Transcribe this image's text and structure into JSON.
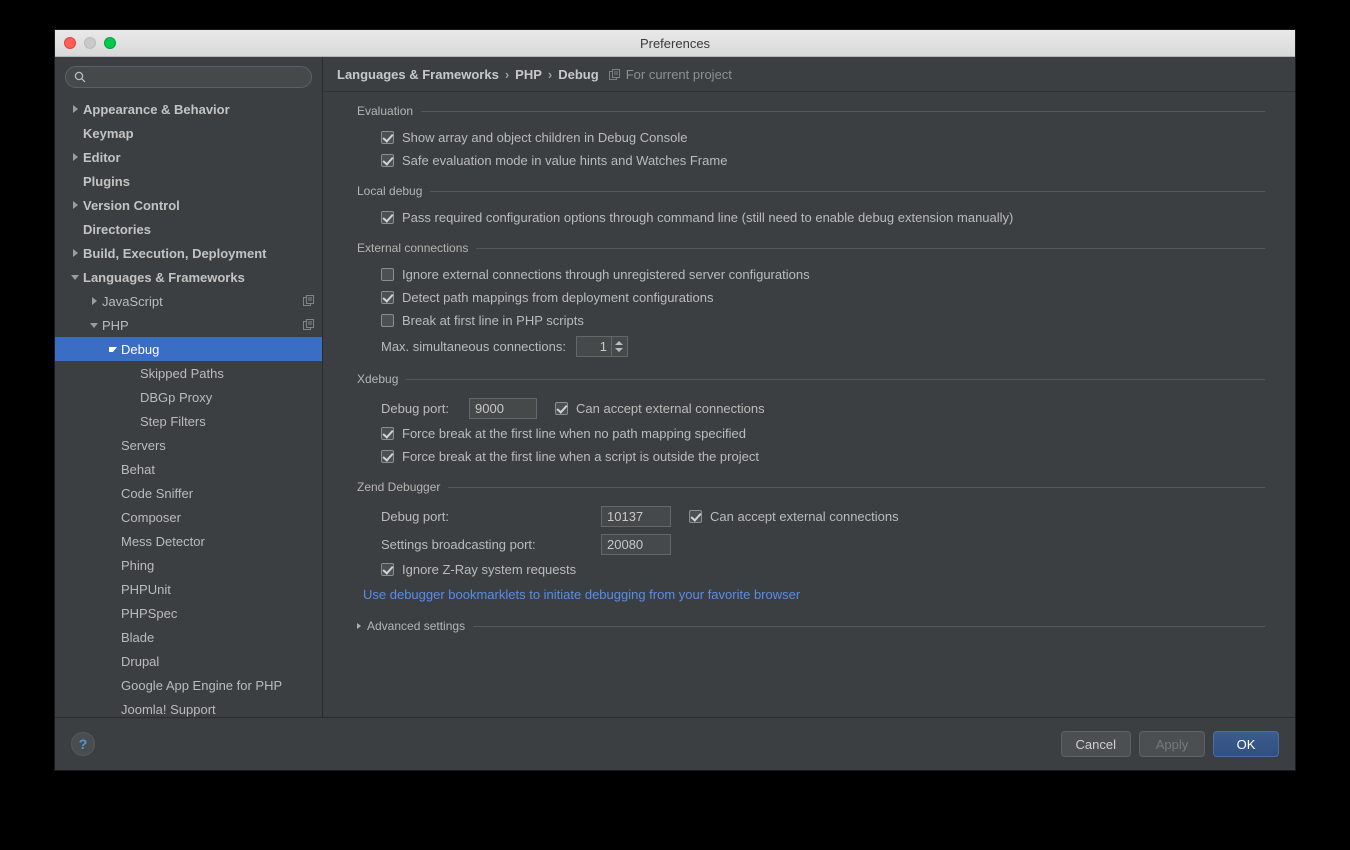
{
  "window": {
    "title": "Preferences",
    "traffic_lights": [
      "close-light",
      "minimize-light",
      "zoom-light"
    ]
  },
  "search": {
    "value": "",
    "placeholder": "",
    "icon": "search-icon"
  },
  "sidebar": {
    "items": [
      {
        "label": "Appearance & Behavior",
        "depth": 0,
        "arrow": "right",
        "bold": true,
        "selected": false,
        "scope_icon": false
      },
      {
        "label": "Keymap",
        "depth": 0,
        "arrow": "none",
        "bold": true,
        "selected": false,
        "scope_icon": false
      },
      {
        "label": "Editor",
        "depth": 0,
        "arrow": "right",
        "bold": true,
        "selected": false,
        "scope_icon": false
      },
      {
        "label": "Plugins",
        "depth": 0,
        "arrow": "none",
        "bold": true,
        "selected": false,
        "scope_icon": false
      },
      {
        "label": "Version Control",
        "depth": 0,
        "arrow": "right",
        "bold": true,
        "selected": false,
        "scope_icon": false
      },
      {
        "label": "Directories",
        "depth": 0,
        "arrow": "none",
        "bold": true,
        "selected": false,
        "scope_icon": false
      },
      {
        "label": "Build, Execution, Deployment",
        "depth": 0,
        "arrow": "right",
        "bold": true,
        "selected": false,
        "scope_icon": false
      },
      {
        "label": "Languages & Frameworks",
        "depth": 0,
        "arrow": "down",
        "bold": true,
        "selected": false,
        "scope_icon": false
      },
      {
        "label": "JavaScript",
        "depth": 1,
        "arrow": "right",
        "bold": false,
        "selected": false,
        "scope_icon": true
      },
      {
        "label": "PHP",
        "depth": 1,
        "arrow": "down",
        "bold": false,
        "selected": false,
        "scope_icon": true
      },
      {
        "label": "Debug",
        "depth": 2,
        "arrow": "down",
        "bold": false,
        "selected": true,
        "scope_icon": false
      },
      {
        "label": "Skipped Paths",
        "depth": 3,
        "arrow": "none",
        "bold": false,
        "selected": false,
        "scope_icon": false
      },
      {
        "label": "DBGp Proxy",
        "depth": 3,
        "arrow": "none",
        "bold": false,
        "selected": false,
        "scope_icon": false
      },
      {
        "label": "Step Filters",
        "depth": 3,
        "arrow": "none",
        "bold": false,
        "selected": false,
        "scope_icon": false
      },
      {
        "label": "Servers",
        "depth": 2,
        "arrow": "none",
        "bold": false,
        "selected": false,
        "scope_icon": false
      },
      {
        "label": "Behat",
        "depth": 2,
        "arrow": "none",
        "bold": false,
        "selected": false,
        "scope_icon": false
      },
      {
        "label": "Code Sniffer",
        "depth": 2,
        "arrow": "none",
        "bold": false,
        "selected": false,
        "scope_icon": false
      },
      {
        "label": "Composer",
        "depth": 2,
        "arrow": "none",
        "bold": false,
        "selected": false,
        "scope_icon": false
      },
      {
        "label": "Mess Detector",
        "depth": 2,
        "arrow": "none",
        "bold": false,
        "selected": false,
        "scope_icon": false
      },
      {
        "label": "Phing",
        "depth": 2,
        "arrow": "none",
        "bold": false,
        "selected": false,
        "scope_icon": false
      },
      {
        "label": "PHPUnit",
        "depth": 2,
        "arrow": "none",
        "bold": false,
        "selected": false,
        "scope_icon": false
      },
      {
        "label": "PHPSpec",
        "depth": 2,
        "arrow": "none",
        "bold": false,
        "selected": false,
        "scope_icon": false
      },
      {
        "label": "Blade",
        "depth": 2,
        "arrow": "none",
        "bold": false,
        "selected": false,
        "scope_icon": false
      },
      {
        "label": "Drupal",
        "depth": 2,
        "arrow": "none",
        "bold": false,
        "selected": false,
        "scope_icon": false
      },
      {
        "label": "Google App Engine for PHP",
        "depth": 2,
        "arrow": "none",
        "bold": false,
        "selected": false,
        "scope_icon": false
      },
      {
        "label": "Joomla! Support",
        "depth": 2,
        "arrow": "none",
        "bold": false,
        "selected": false,
        "scope_icon": false
      }
    ]
  },
  "breadcrumb": {
    "parts": [
      "Languages & Frameworks",
      "PHP",
      "Debug"
    ],
    "separator": "›",
    "scope_icon": "project-scope-icon",
    "scope_note": "For current project"
  },
  "sections": [
    {
      "title": "Evaluation",
      "collapsible": false,
      "rows": [
        {
          "kind": "checkbox",
          "checked": true,
          "label": "Show array and object children in Debug Console"
        },
        {
          "kind": "checkbox",
          "checked": true,
          "label": "Safe evaluation mode in value hints and Watches Frame"
        }
      ]
    },
    {
      "title": "Local debug",
      "collapsible": false,
      "rows": [
        {
          "kind": "checkbox",
          "checked": true,
          "label": "Pass required configuration options through command line (still need to enable debug extension manually)"
        }
      ]
    },
    {
      "title": "External connections",
      "collapsible": false,
      "rows": [
        {
          "kind": "checkbox",
          "checked": false,
          "label": "Ignore external connections through unregistered server configurations"
        },
        {
          "kind": "checkbox",
          "checked": true,
          "label": "Detect path mappings from deployment configurations"
        },
        {
          "kind": "checkbox",
          "checked": false,
          "label": "Break at first line in PHP scripts"
        },
        {
          "kind": "spinner",
          "label": "Max. simultaneous connections:",
          "value": "1"
        }
      ]
    },
    {
      "title": "Xdebug",
      "collapsible": false,
      "rows": [
        {
          "kind": "port",
          "label": "Debug port:",
          "value": "9000",
          "checkbox_label": "Can accept external connections",
          "checked": true
        },
        {
          "kind": "checkbox",
          "checked": true,
          "label": "Force break at the first line when no path mapping specified"
        },
        {
          "kind": "checkbox",
          "checked": true,
          "label": "Force break at the first line when a script is outside the project"
        }
      ]
    },
    {
      "title": "Zend Debugger",
      "collapsible": false,
      "rows": [
        {
          "kind": "port-wide",
          "label": "Debug port:",
          "value": "10137",
          "checkbox_label": "Can accept external connections",
          "checked": true
        },
        {
          "kind": "port-wide",
          "label": "Settings broadcasting port:",
          "value": "20080",
          "checkbox_label": "",
          "checked": null
        },
        {
          "kind": "checkbox",
          "checked": true,
          "label": "Ignore Z-Ray system requests"
        },
        {
          "kind": "link",
          "label": "Use debugger bookmarklets to initiate debugging from your favorite browser"
        }
      ]
    },
    {
      "title": "Advanced settings",
      "collapsible": true,
      "expanded": false,
      "rows": []
    }
  ],
  "footer": {
    "help_icon": "help-question-icon",
    "help_label": "?",
    "buttons": [
      {
        "label": "Cancel",
        "style": "normal",
        "name": "cancel-button"
      },
      {
        "label": "Apply",
        "style": "disabled",
        "name": "apply-button"
      },
      {
        "label": "OK",
        "style": "default",
        "name": "ok-button"
      }
    ]
  },
  "colors": {
    "window_bg": "#3c3f41",
    "selection_blue": "#3a6dc4",
    "link_blue": "#5a8ce8",
    "text": "#bbbbbb",
    "default_button": "#3b5c8f"
  }
}
